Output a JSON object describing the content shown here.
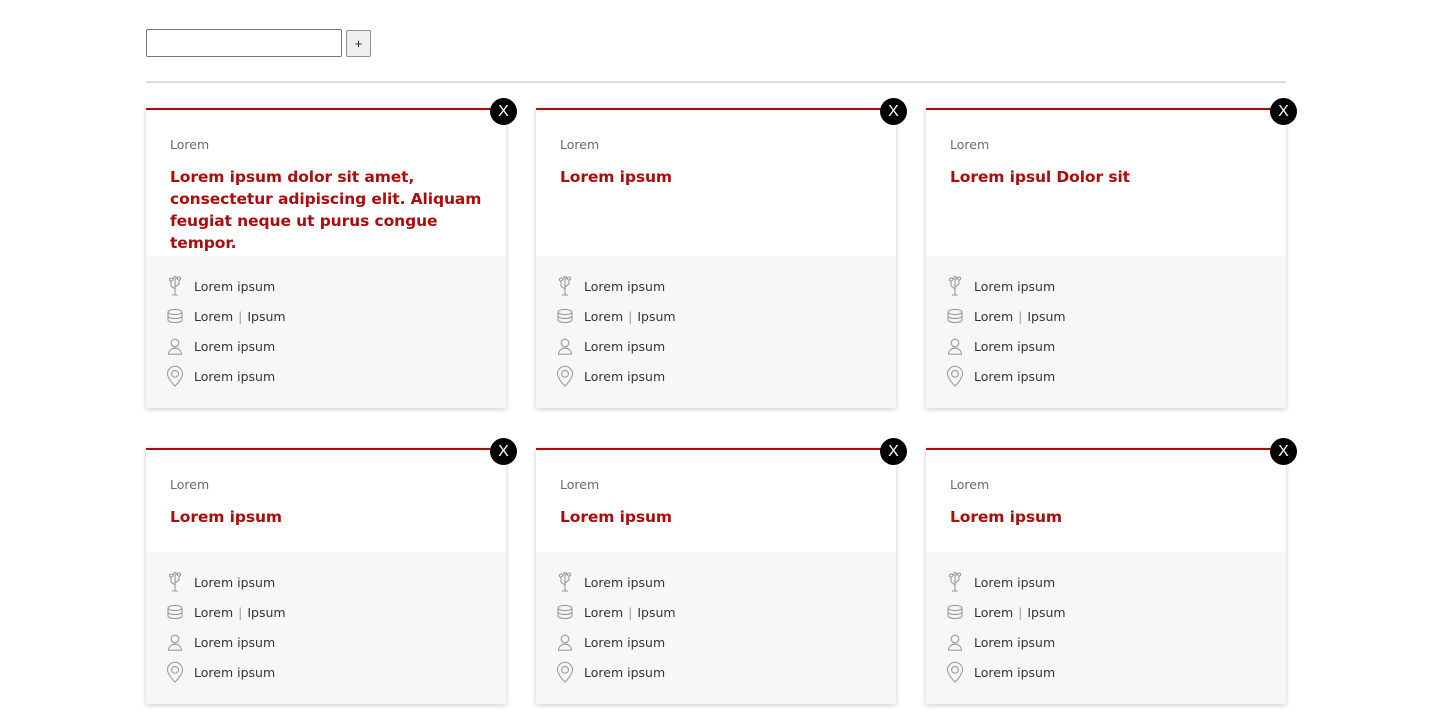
{
  "toolbar": {
    "input_value": "",
    "add_label": "+"
  },
  "cards": [
    {
      "close_label": "X",
      "category": "Lorem",
      "title": "Lorem ipsum dolor sit amet, consectetur adipiscing elit. Aliquam feugiat neque ut purus congue tempor.",
      "meta": {
        "field": "Lorem ipsum",
        "amount_a": "Lorem",
        "amount_b": "Ipsum",
        "person": "Lorem ipsum",
        "location": "Lorem ipsum"
      }
    },
    {
      "close_label": "X",
      "category": "Lorem",
      "title": "Lorem ipsum",
      "meta": {
        "field": "Lorem ipsum",
        "amount_a": "Lorem",
        "amount_b": "Ipsum",
        "person": "Lorem ipsum",
        "location": "Lorem ipsum"
      }
    },
    {
      "close_label": "X",
      "category": "Lorem",
      "title": "Lorem ipsul Dolor sit",
      "meta": {
        "field": "Lorem ipsum",
        "amount_a": "Lorem",
        "amount_b": "Ipsum",
        "person": "Lorem ipsum",
        "location": "Lorem ipsum"
      }
    },
    {
      "close_label": "X",
      "category": "Lorem",
      "title": "Lorem ipsum",
      "meta": {
        "field": "Lorem ipsum",
        "amount_a": "Lorem",
        "amount_b": "Ipsum",
        "person": "Lorem ipsum",
        "location": "Lorem ipsum"
      }
    },
    {
      "close_label": "X",
      "category": "Lorem",
      "title": "Lorem ipsum",
      "meta": {
        "field": "Lorem ipsum",
        "amount_a": "Lorem",
        "amount_b": "Ipsum",
        "person": "Lorem ipsum",
        "location": "Lorem ipsum"
      }
    },
    {
      "close_label": "X",
      "category": "Lorem",
      "title": "Lorem ipsum",
      "meta": {
        "field": "Lorem ipsum",
        "amount_a": "Lorem",
        "amount_b": "Ipsum",
        "person": "Lorem ipsum",
        "location": "Lorem ipsum"
      }
    }
  ],
  "colors": {
    "accent": "#b00b0b",
    "meta_background": "#f7f7f7",
    "icon_stroke": "#9b9b9b"
  },
  "icons": [
    "tree-icon",
    "coins-icon",
    "person-icon",
    "location-pin-icon",
    "close-icon"
  ]
}
